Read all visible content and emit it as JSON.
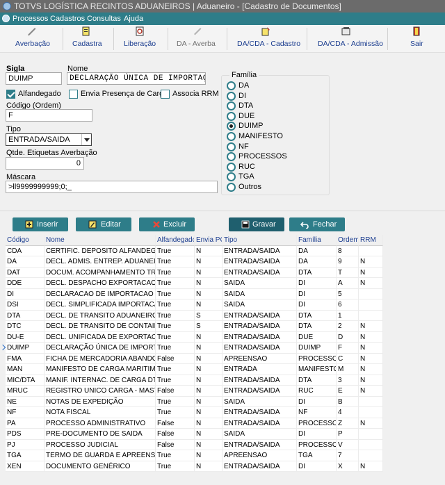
{
  "window": {
    "title": "TOTVS LOGÍSTICA RECINTOS ADUANEIROS | Aduaneiro - [Cadastro de Documentos]"
  },
  "menu": [
    "Processos",
    "Cadastros",
    "Consultas",
    "Ajuda"
  ],
  "toolbar": [
    {
      "label": "Averbação",
      "icon": "averbacao-icon",
      "enabled": true
    },
    {
      "label": "Cadastra",
      "icon": "cadastra-icon",
      "enabled": true
    },
    {
      "label": "Liberação",
      "icon": "liberacao-icon",
      "enabled": true
    },
    {
      "label": "DA - Averba",
      "icon": "da-averba-icon",
      "enabled": false
    },
    {
      "label": "DA/CDA - Cadastro",
      "icon": "da-cda-cadastro-icon",
      "enabled": true
    },
    {
      "label": "DA/CDA - Admissão",
      "icon": "da-cda-admissao-icon",
      "enabled": true
    },
    {
      "label": "Sair",
      "icon": "sair-icon",
      "enabled": true
    }
  ],
  "form": {
    "sigla_label": "Sigla",
    "sigla_value": "DUIMP",
    "nome_label": "Nome",
    "nome_value": "DECLARAÇÃO ÚNICA DE IMPORTAÇÃO",
    "alfandegado_label": "Alfandegado",
    "alfandegado_checked": true,
    "envia_label": "Envia Presença de Carga",
    "envia_checked": false,
    "rrm_label": "Associa RRM",
    "rrm_checked": false,
    "codigo_label": "Código (Ordem)",
    "codigo_value": "F",
    "tipo_label": "Tipo",
    "tipo_value": "ENTRADA/SAIDA",
    "etiquetas_label": "Qtde. Etiquetas Averbação",
    "etiquetas_value": "0",
    "mascara_label": "Máscara",
    "mascara_value": ">ll9999999999;0;_"
  },
  "familia": {
    "title": "Família",
    "options": [
      "DA",
      "DI",
      "DTA",
      "DUE",
      "DUIMP",
      "MANIFESTO",
      "NF",
      "PROCESSOS",
      "RUC",
      "TGA",
      "Outros"
    ],
    "selected": "DUIMP"
  },
  "actions": {
    "inserir": "Inserir",
    "editar": "Editar",
    "excluir": "Excluir",
    "gravar": "Gravar",
    "fechar": "Fechar"
  },
  "table": {
    "columns": [
      "Código",
      "Nome",
      "Alfandegado",
      "Envia PC",
      "Tipo",
      "Família",
      "Ordem",
      "RRM"
    ],
    "current_row": 9,
    "rows": [
      [
        "CDA",
        "CERTIFIC. DEPOSITO ALFANDEGADO",
        "True",
        "N",
        "ENTRADA/SAIDA",
        "DA",
        "8",
        ""
      ],
      [
        "DA",
        "DECL. ADMIS. ENTREP. ADUANEIRO",
        "True",
        "N",
        "ENTRADA/SAIDA",
        "DA",
        "9",
        "N"
      ],
      [
        "DAT",
        "DOCUM. ACOMPANHAMENTO TRANSITO",
        "True",
        "N",
        "ENTRADA/SAIDA",
        "DTA",
        "T",
        "N"
      ],
      [
        "DDE",
        "DECL. DESPACHO EXPORTACAO",
        "True",
        "N",
        "SAIDA",
        "DI",
        "A",
        "N"
      ],
      [
        "DI",
        "DECLARACAO DE IMPORTACAO",
        "True",
        "N",
        "SAIDA",
        "DI",
        "5",
        ""
      ],
      [
        "DSI",
        "DECL. SIMPLIFICADA IMPORTACAO",
        "True",
        "N",
        "SAIDA",
        "DI",
        "6",
        ""
      ],
      [
        "DTA",
        "DECL. DE TRANSITO ADUANEIRO",
        "True",
        "S",
        "ENTRADA/SAIDA",
        "DTA",
        "1",
        ""
      ],
      [
        "DTC",
        "DECL. DE TRANSITO DE CONTAINER",
        "True",
        "S",
        "ENTRADA/SAIDA",
        "DTA",
        "2",
        "N"
      ],
      [
        "DU-E",
        "DECL. UNIFICADA DE EXPORTACAO",
        "True",
        "N",
        "ENTRADA/SAIDA",
        "DUE",
        "D",
        "N"
      ],
      [
        "DUIMP",
        "DECLARAÇÃO ÚNICA DE IMPORTAÇÃO",
        "True",
        "N",
        "ENTRADA/SAIDA",
        "DUIMP",
        "F",
        "N"
      ],
      [
        "FMA",
        "FICHA DE MERCADORIA ABANDONADA",
        "False",
        "N",
        "APREENSAO",
        "PROCESSOS",
        "C",
        "N"
      ],
      [
        "MAN",
        "MANIFESTO DE CARGA MARITIMO",
        "True",
        "N",
        "ENTRADA",
        "MANIFESTO",
        "M",
        "N"
      ],
      [
        "MIC/DTA",
        "MANIF. INTERNAC. DE CARGA DTA",
        "True",
        "N",
        "ENTRADA/SAIDA",
        "DTA",
        "3",
        "N"
      ],
      [
        "MRUC",
        "REGISTRO UNICO CARGA - MASTER",
        "False",
        "N",
        "ENTRADA/SAIDA",
        "RUC",
        "E",
        "N"
      ],
      [
        "NE",
        "NOTAS DE EXPEDIÇÃO",
        "True",
        "N",
        "SAIDA",
        "DI",
        "B",
        ""
      ],
      [
        "NF",
        "NOTA FISCAL",
        "True",
        "N",
        "ENTRADA/SAIDA",
        "NF",
        "4",
        ""
      ],
      [
        "PA",
        "PROCESSO ADMINISTRATIVO",
        "False",
        "N",
        "ENTRADA/SAIDA",
        "PROCESSOS",
        "Z",
        "N"
      ],
      [
        "PDS",
        "PRE-DOCUMENTO DE SAIDA",
        "False",
        "N",
        "SAIDA",
        "DI",
        "P",
        ""
      ],
      [
        "PJ",
        "PROCESSO JUDICIAL",
        "False",
        "N",
        "ENTRADA/SAIDA",
        "PROCESSOS",
        "V",
        ""
      ],
      [
        "TGA",
        "TERMO DE GUARDA E APREENSÃO",
        "True",
        "N",
        "APREENSAO",
        "TGA",
        "7",
        ""
      ],
      [
        "XEN",
        "DOCUMENTO GENÉRICO",
        "True",
        "N",
        "ENTRADA/SAIDA",
        "DI",
        "X",
        "N"
      ]
    ]
  },
  "colors": {
    "accent": "#2e7d89",
    "title_bar": "#6b6b6b",
    "link_blue": "#1b3d8f"
  }
}
